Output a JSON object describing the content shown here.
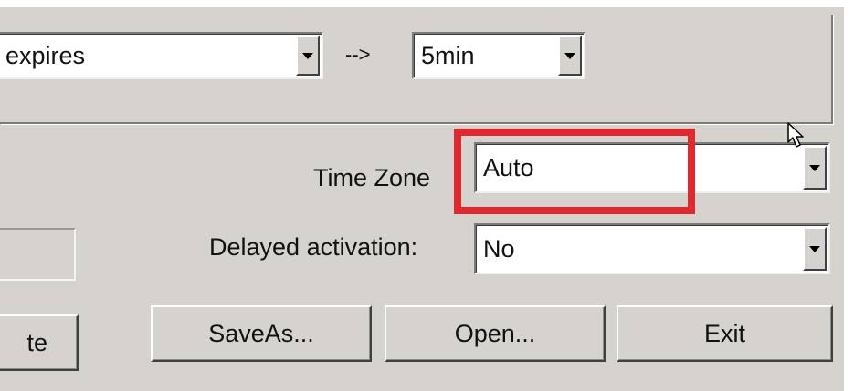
{
  "expire_row": {
    "condition_value": "expires",
    "arrow_text": "-->",
    "interval_value": "5min"
  },
  "time_zone": {
    "label": "Time Zone",
    "value": "Auto"
  },
  "delayed_activation": {
    "label": "Delayed activation:",
    "value": "No"
  },
  "buttons": {
    "partial_label": "te",
    "save_as": "SaveAs...",
    "open": "Open...",
    "exit": "Exit"
  },
  "highlight_color": "#e0282e",
  "icons": [
    "dropdown-arrow-icon",
    "mouse-cursor-icon"
  ]
}
